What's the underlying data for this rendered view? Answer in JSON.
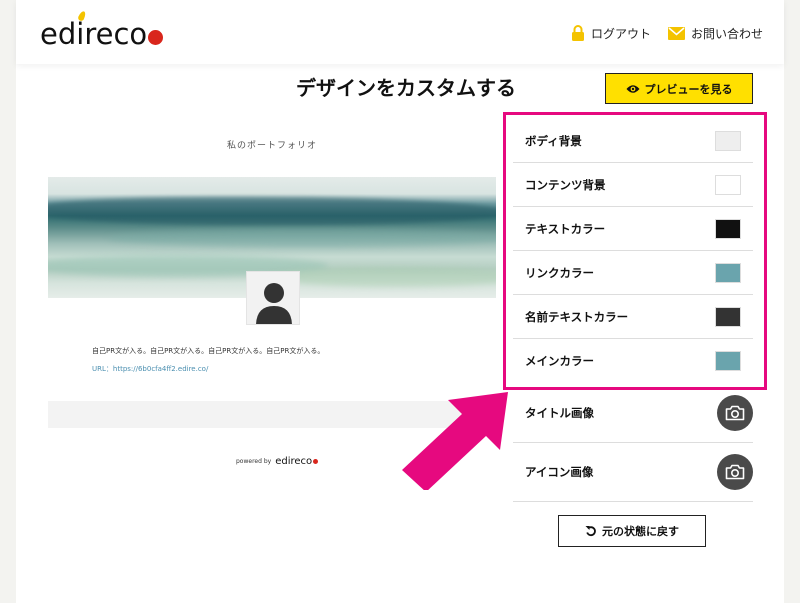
{
  "header": {
    "logo_prefix": "ed",
    "logo_mid": "i",
    "logo_suffix": "reco",
    "logout_label": "ログアウト",
    "contact_label": "お問い合わせ"
  },
  "main": {
    "title": "デザインをカスタムする",
    "preview_label": "プレビューを見る",
    "reset_label": "元の状態に戻す"
  },
  "preview": {
    "portfolio_title": "私のポートフォリオ",
    "pr_text": "自己PR文が入る。自己PR文が入る。自己PR文が入る。自己PR文が入る。",
    "url_text": "URL：https://6b0cfa4ff2.edire.co/",
    "powered_by": "powered by",
    "mini_logo_prefix": "ed",
    "mini_logo_mid": "i",
    "mini_logo_suffix": "reco"
  },
  "settings": {
    "colors": [
      {
        "label": "ボディ背景",
        "color": "#eeeeee"
      },
      {
        "label": "コンテンツ背景",
        "color": "#ffffff"
      },
      {
        "label": "テキストカラー",
        "color": "#111111"
      },
      {
        "label": "リンクカラー",
        "color": "#6aa4ad"
      },
      {
        "label": "名前テキストカラー",
        "color": "#333333"
      },
      {
        "label": "メインカラー",
        "color": "#6aa4ad"
      }
    ],
    "images": [
      {
        "label": "タイトル画像",
        "icon": "camera-icon"
      },
      {
        "label": "アイコン画像",
        "icon": "camera-icon"
      }
    ]
  },
  "theme": {
    "accent_yellow": "#ffe000",
    "highlight_pink": "#e6097f",
    "logo_red": "#d9261c"
  }
}
